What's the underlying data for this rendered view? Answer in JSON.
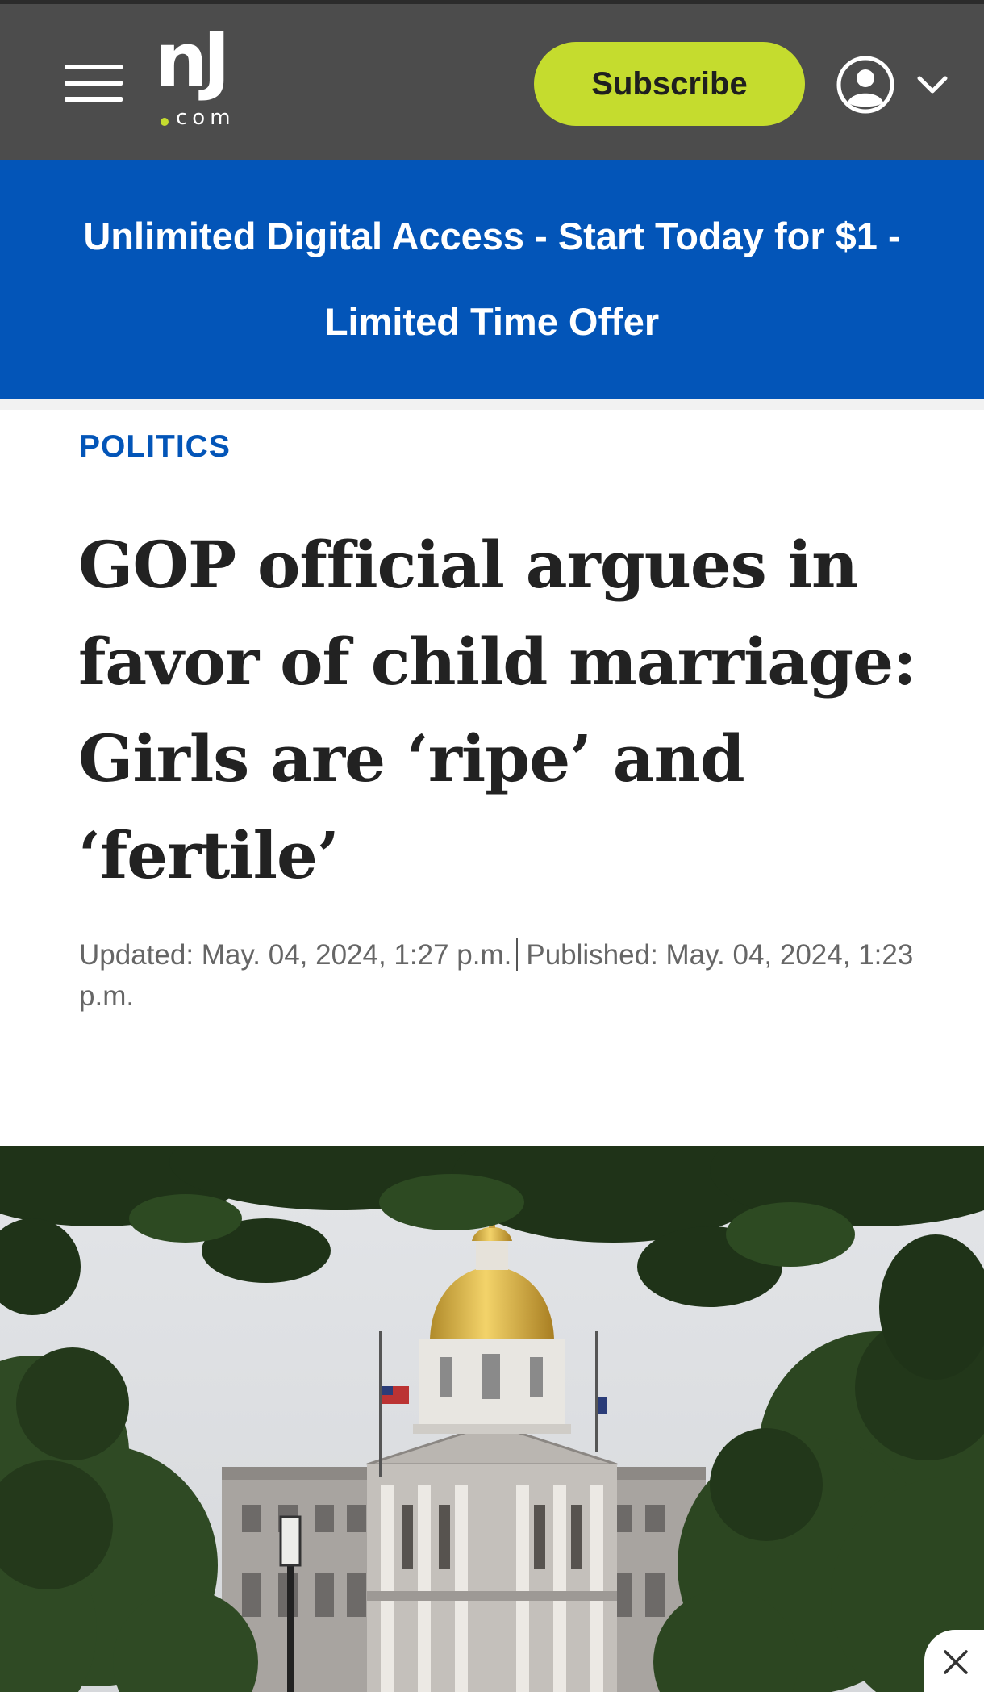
{
  "header": {
    "logo_main": "nJ",
    "logo_sub": "com",
    "subscribe_label": "Subscribe"
  },
  "promo": {
    "text": "Unlimited Digital Access - Start Today for $1 - Limited Time Offer"
  },
  "article": {
    "category": "POLITICS",
    "headline": "GOP official argues in favor of child marriage: Girls are ‘ripe’ and ‘fertile’",
    "updated": "Updated: May. 04, 2024, 1:27 p.m.",
    "published": "Published: May. 04, 2024, 1:23 p.m."
  },
  "colors": {
    "header_bg": "#4c4c4c",
    "subscribe_bg": "#c5dc2e",
    "promo_bg": "#0355b8",
    "category": "#0355b8"
  },
  "icons": [
    "hamburger-menu-icon",
    "account-icon",
    "chevron-down-icon",
    "close-icon"
  ]
}
